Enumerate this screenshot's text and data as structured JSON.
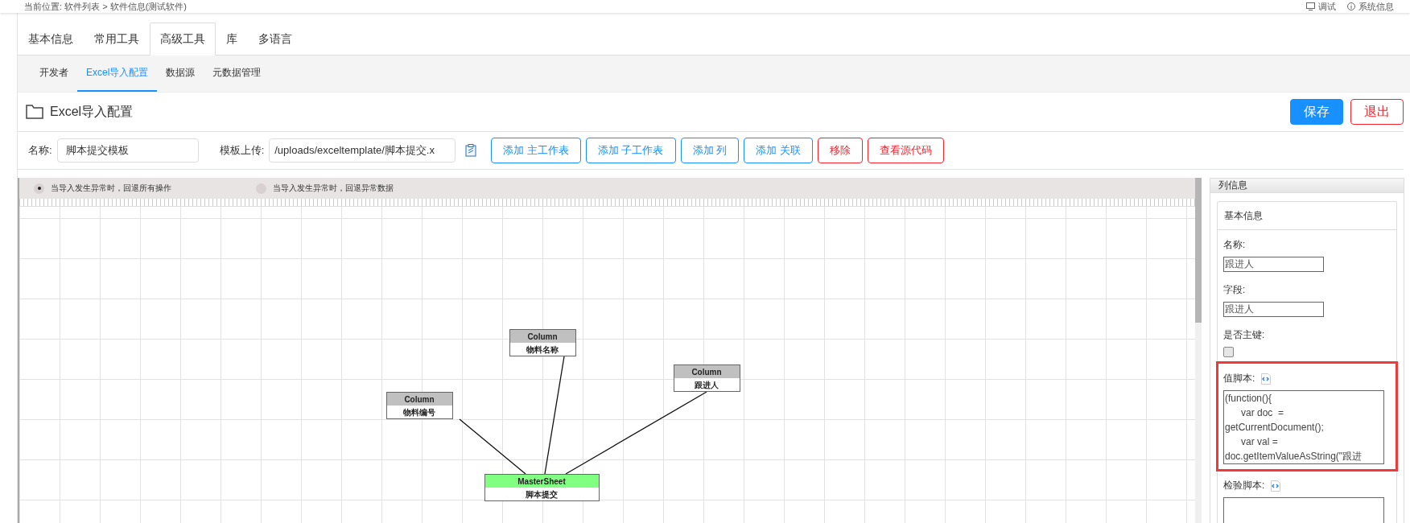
{
  "breadcrumb": "当前位置: 软件列表 > 软件信息(测试软件)",
  "header_links": [
    "调试",
    "系统信息"
  ],
  "tabs": [
    {
      "label": "基本信息",
      "selected": false
    },
    {
      "label": "常用工具",
      "selected": false
    },
    {
      "label": "高级工具",
      "selected": true
    },
    {
      "label": "库",
      "selected": false
    },
    {
      "label": "多语言",
      "selected": false
    }
  ],
  "subtabs": [
    {
      "label": "开发者",
      "selected": false
    },
    {
      "label": "Excel导入配置",
      "selected": true
    },
    {
      "label": "数据源",
      "selected": false
    },
    {
      "label": "元数据管理",
      "selected": false
    }
  ],
  "page_title": "Excel导入配置",
  "header_buttons": [
    {
      "label": "保存",
      "kind": "primary"
    },
    {
      "label": "退出",
      "kind": "danger"
    }
  ],
  "form": {
    "name_label": "名称:",
    "name_value": "脚本提交模板",
    "template_label": "模板上传:",
    "template_value": "/uploads/exceltemplate/脚本提交.x"
  },
  "toolbar_buttons": [
    {
      "label": "添加 主工作表",
      "kind": "primary"
    },
    {
      "label": "添加 子工作表",
      "kind": "primary"
    },
    {
      "label": "添加 列",
      "kind": "primary"
    },
    {
      "label": "添加 关联",
      "kind": "primary"
    },
    {
      "label": "移除",
      "kind": "danger"
    },
    {
      "label": "查看源代码",
      "kind": "danger"
    }
  ],
  "rollback_options": [
    {
      "label": "当导入发生异常时，回退所有操作",
      "selected": true
    },
    {
      "label": "当导入发生异常时，回退异常数据",
      "selected": false
    }
  ],
  "diagram": {
    "nodes": [
      {
        "kind": "column",
        "type_label": "Column",
        "name": "物料名称"
      },
      {
        "kind": "column",
        "type_label": "Column",
        "name": "跟进人"
      },
      {
        "kind": "column",
        "type_label": "Column",
        "name": "物料编号"
      },
      {
        "kind": "master",
        "type_label": "MasterSheet",
        "name": "脚本提交"
      }
    ]
  },
  "column_panel": {
    "title": "列信息",
    "section_title": "基本信息",
    "fields": [
      {
        "kind": "text",
        "label": "名称:",
        "value": "跟进人"
      },
      {
        "kind": "text",
        "label": "字段:",
        "value": "跟进人"
      },
      {
        "kind": "checkbox",
        "label": "是否主键:",
        "checked": false
      },
      {
        "kind": "script",
        "label": "值脚本:",
        "value": "(function(){\n\tvar doc  = getCurrentDocument();\n\tvar val = doc.getItemValueAsString(\"跟进",
        "highlighted": true
      },
      {
        "kind": "script",
        "label": "检验脚本:",
        "highlighted": false
      }
    ]
  }
}
